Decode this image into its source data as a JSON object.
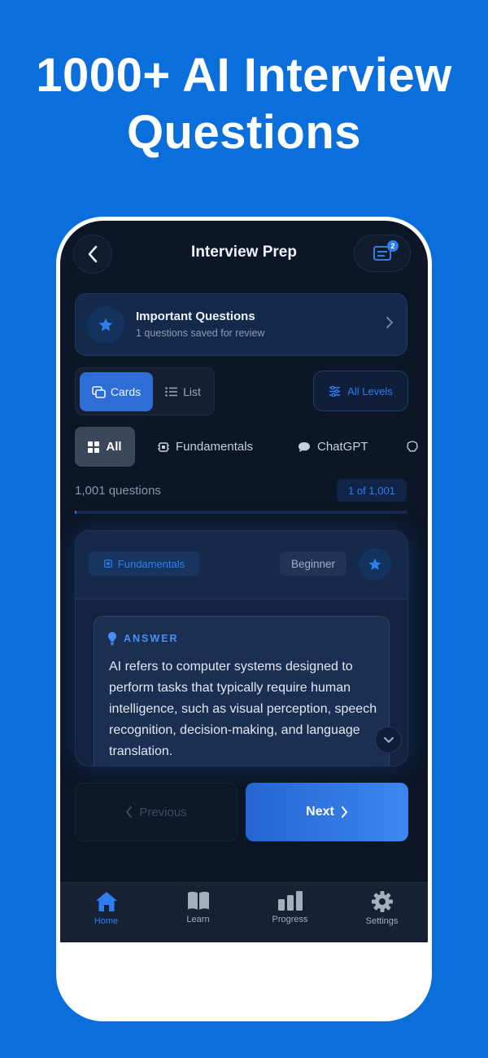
{
  "headline": {
    "line1": "1000+ AI Interview",
    "line2": "Questions"
  },
  "header": {
    "title": "Interview Prep",
    "notes_badge": "2"
  },
  "important": {
    "title": "Important Questions",
    "subtitle": "1 questions saved for review"
  },
  "view_toggle": {
    "cards_label": "Cards",
    "list_label": "List",
    "selected": "Cards"
  },
  "levels_filter": {
    "label": "All Levels"
  },
  "categories": {
    "items": [
      {
        "label": "All",
        "icon": "grid-icon",
        "selected": true
      },
      {
        "label": "Fundamentals",
        "icon": "chip-icon",
        "selected": false
      },
      {
        "label": "ChatGPT",
        "icon": "chat-bubble-icon",
        "selected": false
      }
    ]
  },
  "counts": {
    "total_text": "1,001 questions",
    "position_text": "1 of 1,001",
    "progress_fraction": 0.001
  },
  "question_card": {
    "category": "Fundamentals",
    "level": "Beginner",
    "answer_label": "ANSWER",
    "answer_text": "AI refers to computer systems designed to perform tasks that typically require human intelligence, such as visual perception, speech recognition, decision-making, and language translation."
  },
  "navigation": {
    "previous_label": "Previous",
    "next_label": "Next"
  },
  "tabbar": {
    "items": [
      {
        "label": "Home",
        "icon": "home-icon",
        "active": true
      },
      {
        "label": "Learn",
        "icon": "book-icon",
        "active": false
      },
      {
        "label": "Progress",
        "icon": "bar-chart-icon",
        "active": false
      },
      {
        "label": "Settings",
        "icon": "gear-icon",
        "active": false
      }
    ]
  },
  "colors": {
    "background": "#0a6fdb",
    "accent": "#2f7ef0",
    "screen": "#0c1626"
  }
}
